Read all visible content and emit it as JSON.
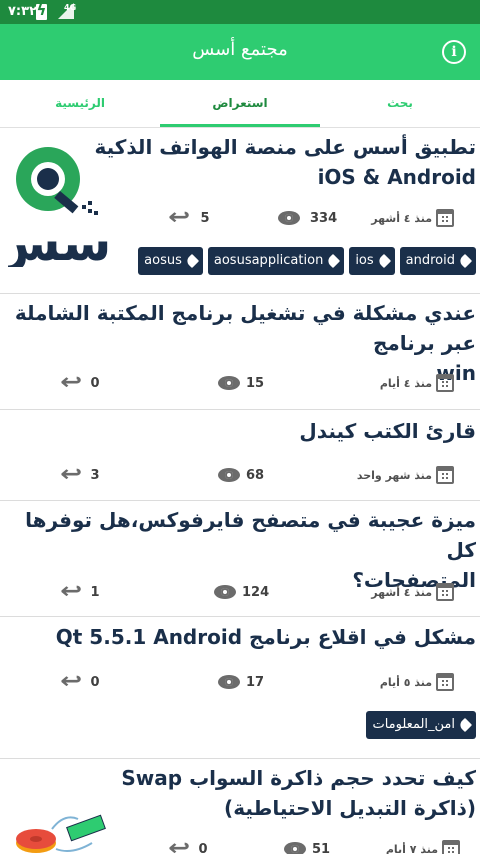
{
  "status_bar": {
    "time": "٧:٣٢",
    "network": "4G"
  },
  "app_bar": {
    "title": "مجتمع أسس",
    "info_icon": "info-icon"
  },
  "tabs": [
    {
      "label": "الرئيسية"
    },
    {
      "label": "استعراض"
    },
    {
      "label": "بحث"
    }
  ],
  "colors": {
    "primary": "#2ecc71",
    "status": "#1e8a3e",
    "navy": "#1a2f4a"
  },
  "posts": [
    {
      "title_line1": "تطبيق أسس على منصة الهواتف الذكية",
      "title_line2": "iOS & Android",
      "date": "منذ ٤ أشهر",
      "views": "334",
      "replies": "5",
      "tags": [
        "android",
        "ios",
        "aosusapplication",
        "aosus"
      ],
      "logo_text": "أسس"
    },
    {
      "title_line1": "عندي مشكلة في تشغيل برنامج المكتبة الشاملة عبر برنامج",
      "title_line2": "win",
      "date": "منذ ٤ أيام",
      "views": "15",
      "replies": "0"
    },
    {
      "title_line1": "قارئ الكتب كيندل",
      "date": "منذ شهر واحد",
      "views": "68",
      "replies": "3"
    },
    {
      "title_line1": "ميزة عجيبة في متصفح فايرفوكس،هل توفرها كل",
      "title_line2": "المتصفحات؟",
      "date": "منذ ٤ أشهر",
      "views": "124",
      "replies": "1"
    },
    {
      "title_line1": "مشكل في اقلاع برنامج Qt 5.5.1 Android",
      "date": "منذ ٥ أيام",
      "views": "17",
      "replies": "0",
      "tags": [
        "امن_المعلومات"
      ]
    },
    {
      "title_line1": "كيف تحدد حجم ذاكرة السواب Swap",
      "title_line2": "(ذاكرة التبديل الاحتياطية)",
      "date": "منذ ٧ أيام",
      "views": "51",
      "replies": "0"
    }
  ]
}
